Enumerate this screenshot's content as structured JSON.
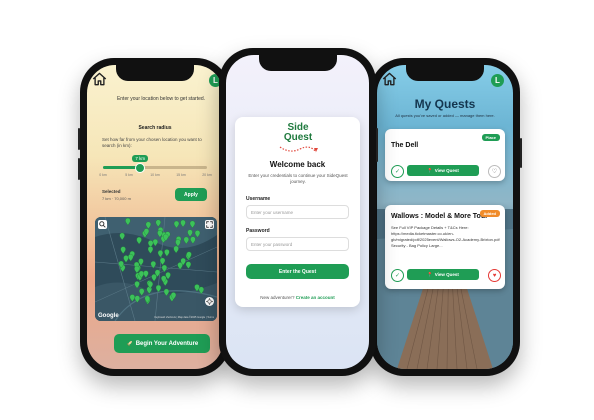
{
  "colors": {
    "brand_green": "#1f9d55",
    "logo_green": "#1f7a3e",
    "place_badge": "#1f9d55",
    "orange_badge": "#f08c2a",
    "heart_red": "#e53935"
  },
  "left_phone": {
    "avatar_letter": "L",
    "intro_text": "Enter your location below to get started.",
    "radius_title": "Search radius",
    "radius_desc": "Set how far from your chosen location you want to search (in km):",
    "slider": {
      "value_label": "7 km",
      "fraction": 0.35,
      "ticks": [
        "0 km",
        "5 km",
        "10 km",
        "15 km",
        "20 km"
      ]
    },
    "selected_label": "Selected",
    "selected_value": "7 km · 70,000 m",
    "apply_label": "Apply",
    "map": {
      "google": "Google",
      "attribution": "Keyboard shortcuts | Map data ©2025 Google | Terms"
    },
    "begin_label": "Begin Your Adventure",
    "begin_icon": "rocket-icon"
  },
  "center_phone": {
    "logo_line1": "Side",
    "logo_line2": "Quest",
    "welcome": "Welcome back",
    "desc": "Enter your credentials to continue your SideQuest journey.",
    "username_label": "Username",
    "username_placeholder": "Enter your username",
    "password_label": "Password",
    "password_placeholder": "Enter your password",
    "enter_label": "Enter the Quest",
    "signup_prompt": "New adventurer?",
    "signup_link": "Create an account"
  },
  "right_phone": {
    "avatar_letter": "L",
    "title": "My Quests",
    "subtitle": "All quests you've saved or added — manage them here.",
    "cards": [
      {
        "title": "The Dell",
        "badge": "Place",
        "desc": "",
        "view_label": "View Quest"
      },
      {
        "title": "Wallows : Model & More Tour",
        "badge": "Added",
        "desc": "See Full VIP Package Details + T&Cs Here: https://media.ticketmaster.co.uk/en-gb/migrated/pdf/2025event/Wallows-O2-Academy-Brixton.pdf Security - Bag Policy Large...",
        "view_label": "View Quest"
      }
    ]
  }
}
